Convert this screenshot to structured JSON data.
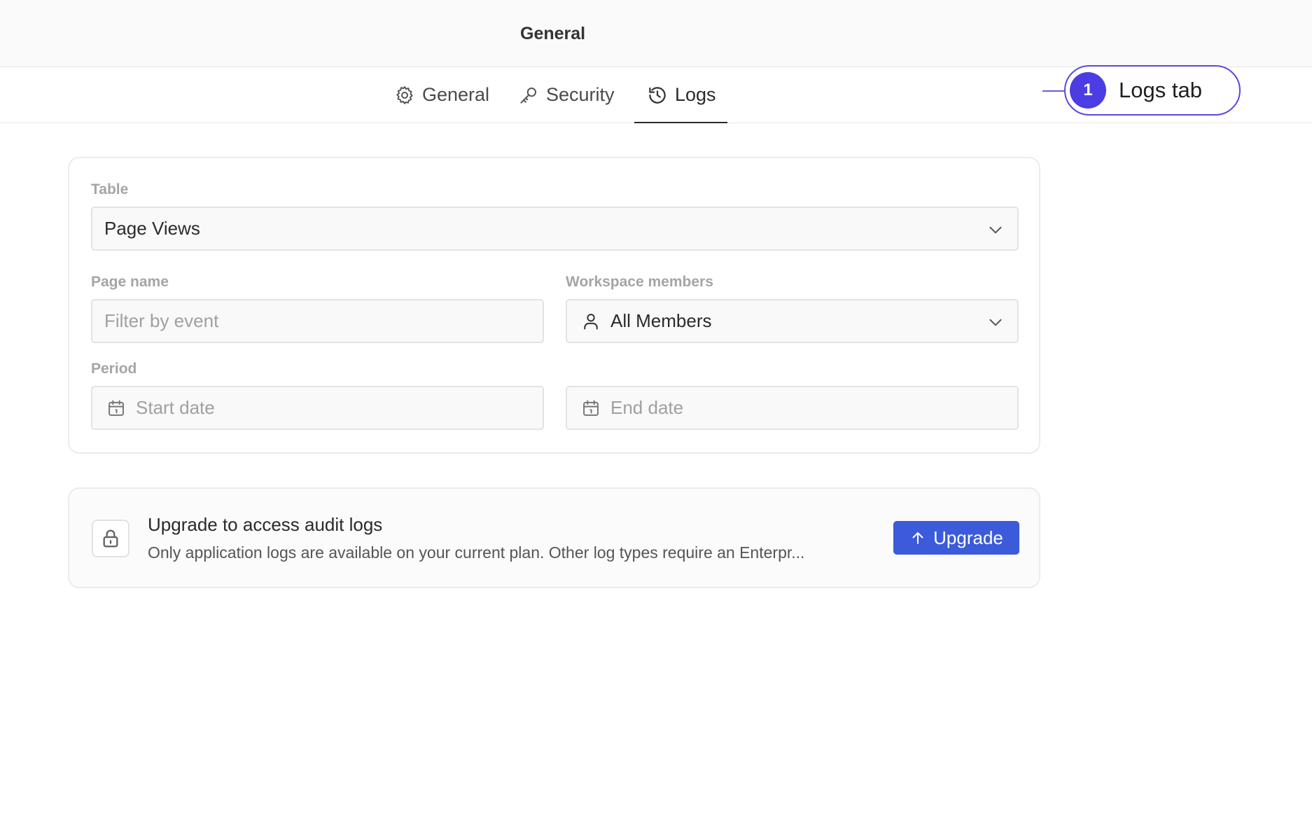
{
  "header": {
    "title": "General"
  },
  "tabs": [
    {
      "label": "General",
      "icon": "gear-icon"
    },
    {
      "label": "Security",
      "icon": "key-icon"
    },
    {
      "label": "Logs",
      "icon": "history-icon",
      "active": true
    }
  ],
  "callout": {
    "number": "1",
    "label": "Logs tab",
    "color": "#4b3de3"
  },
  "filters": {
    "table": {
      "label": "Table",
      "value": "Page Views"
    },
    "page_name": {
      "label": "Page name",
      "placeholder": "Filter by event"
    },
    "members": {
      "label": "Workspace members",
      "value": "All Members"
    },
    "period": {
      "label": "Period",
      "start_placeholder": "Start date",
      "end_placeholder": "End date"
    }
  },
  "upgrade": {
    "title": "Upgrade to access audit logs",
    "description": "Only application logs are available on your current plan. Other log types require an Enterpr...",
    "button_label": "Upgrade",
    "button_color": "#3b5bdb"
  }
}
